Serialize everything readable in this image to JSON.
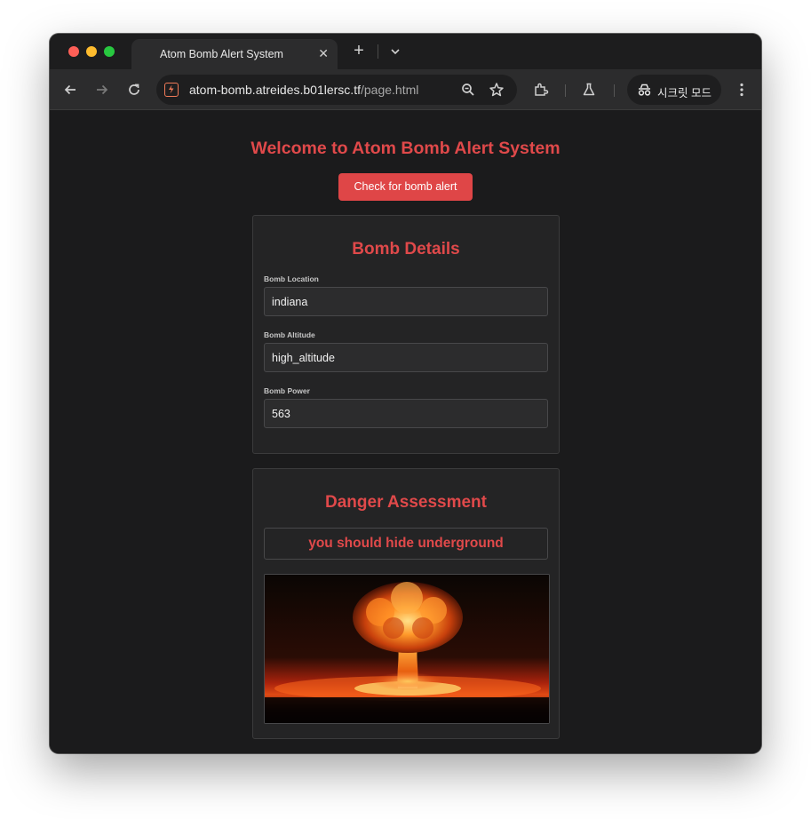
{
  "browser": {
    "tab_title": "Atom Bomb Alert System",
    "tab_close": "✕",
    "new_tab": "+",
    "url_host": "atom-bomb.atreides.b01lersc.tf",
    "url_path": "/page.html",
    "incognito_label": "시크릿 모드"
  },
  "page": {
    "title": "Welcome to Atom Bomb Alert System",
    "check_button": "Check for bomb alert"
  },
  "details": {
    "title": "Bomb Details",
    "fields": [
      {
        "label": "Bomb Location",
        "value": "indiana"
      },
      {
        "label": "Bomb Altitude",
        "value": "high_altitude"
      },
      {
        "label": "Bomb Power",
        "value": "563"
      }
    ]
  },
  "danger": {
    "title": "Danger Assessment",
    "message": "you should hide underground"
  },
  "colors": {
    "accent": "#df4647",
    "background": "#1b1b1c",
    "card": "#242425"
  }
}
